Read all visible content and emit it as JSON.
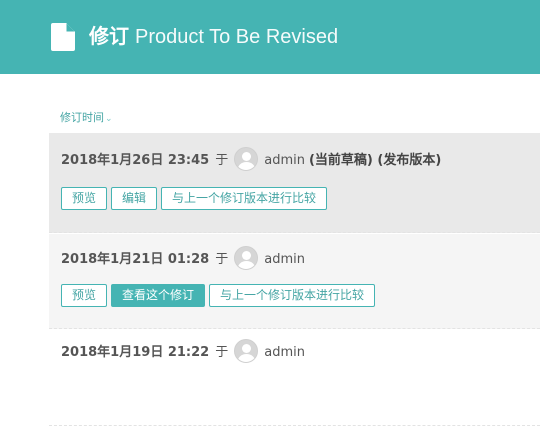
{
  "header": {
    "title_cn": "修订",
    "title_en": "Product To Be Revised",
    "icon": "document-icon"
  },
  "sort": {
    "label": "修订时间",
    "icon": "chevron-down-icon"
  },
  "colors": {
    "accent": "#45b4b3",
    "current_row_bg": "#e9e9e9"
  },
  "revisions": [
    {
      "date": "2018年1月26日 23:45",
      "at": "于",
      "user": "admin",
      "status": "(当前草稿) (发布版本)",
      "buttons": {
        "preview": "预览",
        "edit": "编辑",
        "compare": "与上一个修订版本进行比较"
      }
    },
    {
      "date": "2018年1月21日 01:28",
      "at": "于",
      "user": "admin",
      "buttons": {
        "preview": "预览",
        "view": "查看这个修订",
        "compare": "与上一个修订版本进行比较"
      }
    },
    {
      "date": "2018年1月19日 21:22",
      "at": "于",
      "user": "admin"
    }
  ]
}
